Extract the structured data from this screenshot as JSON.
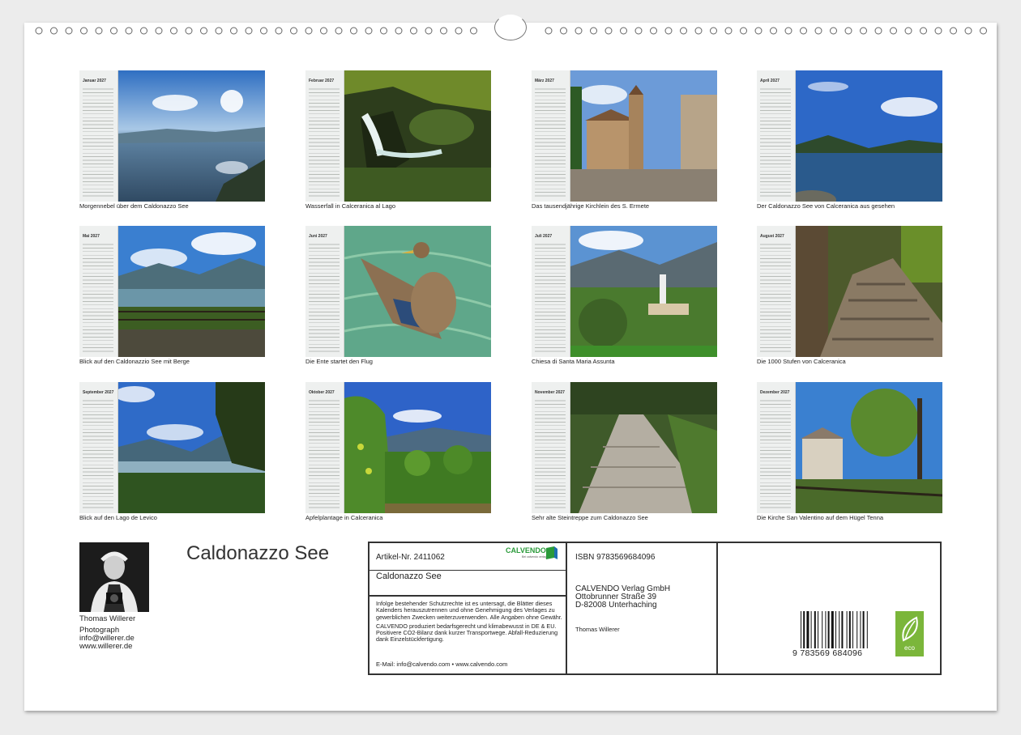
{
  "months": [
    {
      "label": "Januar 2027",
      "caption": "Morgennebel über dem Caldonazzo See"
    },
    {
      "label": "Februar 2027",
      "caption": "Wasserfall in Calceranica al Lago"
    },
    {
      "label": "März 2027",
      "caption": "Das tausendjährige Kirchlein des S. Ermete"
    },
    {
      "label": "April 2027",
      "caption": "Der Caldonazzo See von Calceranica aus gesehen"
    },
    {
      "label": "Mai 2027",
      "caption": "Blick auf den Caldonazzio See mit Berge"
    },
    {
      "label": "Juni 2027",
      "caption": "Die Ente startet den Flug"
    },
    {
      "label": "Juli 2027",
      "caption": "Chiesa di Santa Maria Assunta"
    },
    {
      "label": "August 2027",
      "caption": "Die 1000 Stufen von Calceranica"
    },
    {
      "label": "September 2027",
      "caption": "Blick auf den Lago de Levico"
    },
    {
      "label": "Oktober 2027",
      "caption": "Apfelplantage in Calceranica"
    },
    {
      "label": "November 2027",
      "caption": "Sehr alte Steintreppe zum Caldonazzo See"
    },
    {
      "label": "Dezember 2027",
      "caption": "Die Kirche San Valentino auf dem Hügel Tenna"
    }
  ],
  "author": {
    "name": "Thomas Willerer",
    "role": "Photograph",
    "email": "info@willerer.de",
    "web": "www.willerer.de"
  },
  "title": "Caldonazzo See",
  "product": {
    "article": "Artikel-Nr. 2411062",
    "title": "Caldonazzo See",
    "brand": "CALVENDO",
    "brand_tagline": "Bei calvendo verlag",
    "legal_1": "Infolge bestehender Schutzrechte ist es untersagt, die Blätter dieses Kalenders herauszutrennen und ohne Genehmigung des Verlages zu gewerblichen Zwecken weiterzuverwenden. Alle Angaben ohne Gewähr.",
    "legal_2": "CALVENDO produziert bedarfsgerecht und klimabewusst in DE & EU. Positivere CO2-Bilanz dank kurzer Transportwege. Abfall-Reduzierung dank Einzelstückfertigung.",
    "contact": "E-Mail: info@calvendo.com • www.calvendo.com",
    "isbn": "ISBN 9783569684096",
    "publisher_name": "CALVENDO Verlag GmbH",
    "publisher_street": "Ottobrunner Straße 39",
    "publisher_city": "D-82008 Unterhaching",
    "author_line": "Thomas Willerer",
    "barcode_number": "9 783569 684096",
    "eco_label": "eco"
  },
  "colors": {
    "eco_green": "#7bb63a",
    "calvendo_green": "#2a9a3a"
  }
}
